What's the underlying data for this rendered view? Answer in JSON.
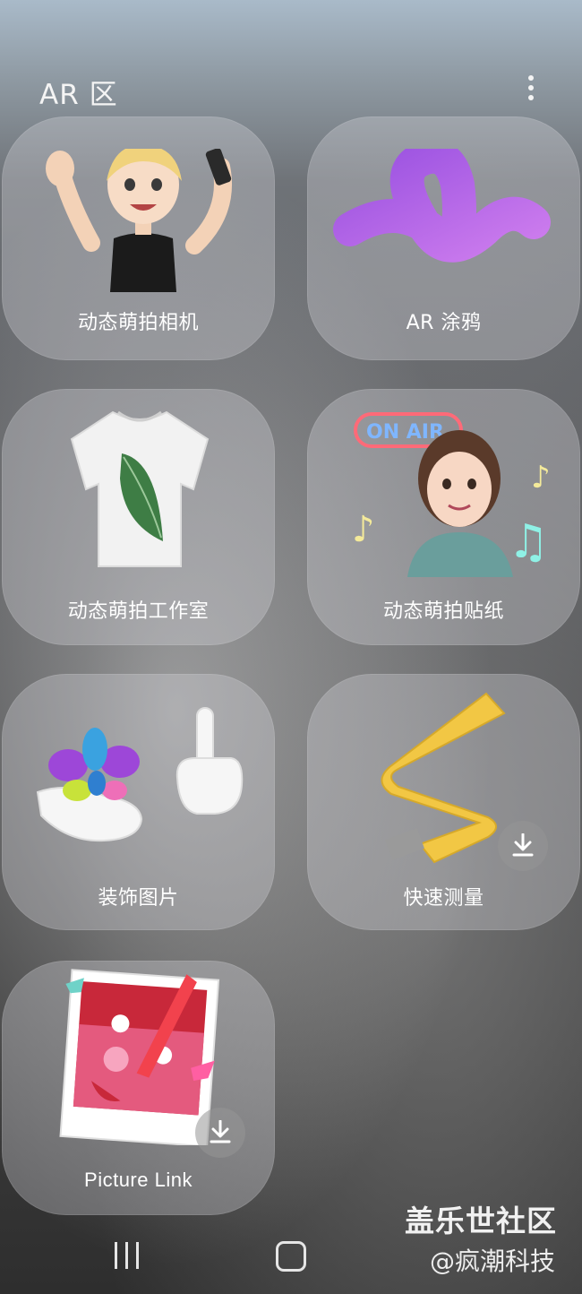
{
  "header": {
    "title": "AR 区",
    "menu_icon": "more-vertical-icon"
  },
  "tiles": [
    {
      "label": "动态萌拍相机",
      "art": "waving-avatar-selfie",
      "downloadable": false
    },
    {
      "label": "AR 涂鸦",
      "art": "purple-squiggle",
      "downloadable": false
    },
    {
      "label": "动态萌拍工作室",
      "art": "leaf-tshirt",
      "downloadable": false
    },
    {
      "label": "动态萌拍贴纸",
      "art": "avatar-on-air-sign",
      "neon_sign": "ON AIR",
      "downloadable": false
    },
    {
      "label": "装饰图片",
      "art": "balloon-hands",
      "downloadable": false
    },
    {
      "label": "快速测量",
      "art": "measuring-tape",
      "downloadable": true
    },
    {
      "label": "Picture Link",
      "art": "polaroid-photo",
      "downloadable": true
    }
  ],
  "navigation": {
    "recents_icon": "recents-icon",
    "home_icon": "home-icon"
  },
  "watermark": {
    "line1": "盖乐世社区",
    "line2": "@疯潮科技"
  },
  "colors": {
    "tile_bg": "#d7d7dc",
    "text": "#ffffff",
    "squiggle": "#b25ef2",
    "tape": "#f2c744"
  }
}
